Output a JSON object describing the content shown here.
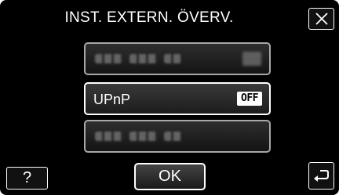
{
  "header": {
    "title": "INST. EXTERN. ÖVERV.",
    "close_icon": "close-icon"
  },
  "settings": {
    "rows": [
      {
        "label": "",
        "value": "",
        "state": "obscured"
      },
      {
        "label": "UPnP",
        "value": "OFF",
        "state": "active"
      },
      {
        "label": "",
        "value": "",
        "state": "obscured"
      }
    ]
  },
  "footer": {
    "help_label": "?",
    "ok_label": "OK",
    "back_icon": "return-arrow-icon"
  },
  "colors": {
    "background": "#000000",
    "text": "#ffffff",
    "badge_bg": "#ffffff",
    "badge_text": "#000000"
  }
}
